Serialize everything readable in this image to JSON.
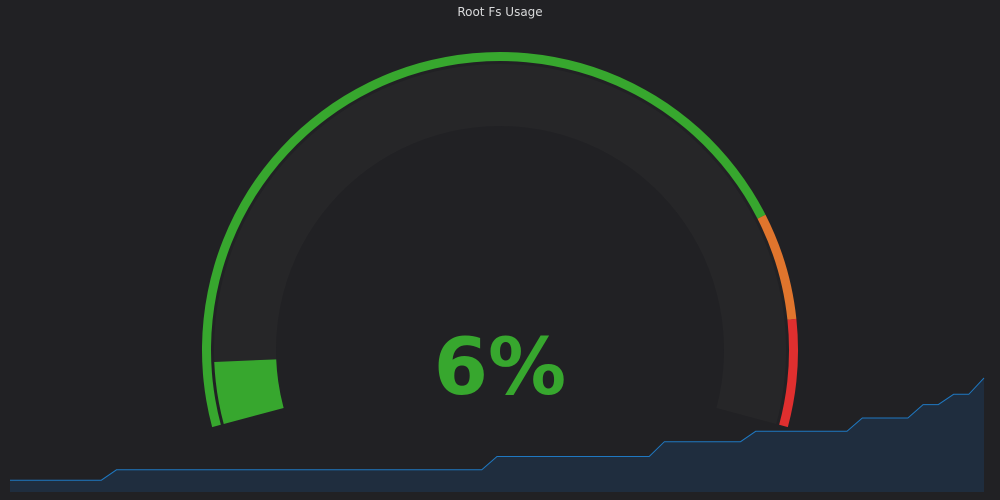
{
  "panel": {
    "title": "Root Fs Usage"
  },
  "gauge": {
    "value": 6,
    "unit": "%",
    "display": "6%",
    "min": 0,
    "max": 100,
    "thresholds": [
      {
        "from": 0,
        "to": 80,
        "color": "#37a72e"
      },
      {
        "from": 80,
        "to": 90,
        "color": "#e0752d"
      },
      {
        "from": 90,
        "to": 100,
        "color": "#e02f2f"
      }
    ],
    "value_color": "#37a72e",
    "track_color": "#262628"
  },
  "sparkline": {
    "line_color": "#1f78c1",
    "fill_color": "#1f2d3e",
    "values": [
      0.8,
      0.8,
      0.8,
      0.8,
      0.8,
      0.8,
      0.8,
      1.5,
      1.5,
      1.5,
      1.5,
      1.5,
      1.5,
      1.5,
      1.5,
      1.5,
      1.5,
      1.5,
      1.5,
      1.5,
      1.5,
      1.5,
      1.5,
      1.5,
      1.5,
      1.5,
      1.5,
      1.5,
      1.5,
      1.5,
      1.5,
      1.5,
      2.4,
      2.4,
      2.4,
      2.4,
      2.4,
      2.4,
      2.4,
      2.4,
      2.4,
      2.4,
      2.4,
      3.4,
      3.4,
      3.4,
      3.4,
      3.4,
      3.4,
      4.1,
      4.1,
      4.1,
      4.1,
      4.1,
      4.1,
      4.1,
      5.0,
      5.0,
      5.0,
      5.0,
      5.9,
      5.9,
      6.6,
      6.6,
      7.7
    ]
  }
}
